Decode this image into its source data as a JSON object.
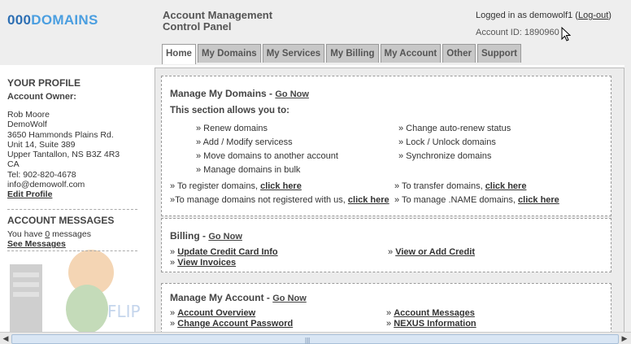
{
  "logo": {
    "part1": "000",
    "part2": "DOMAINS"
  },
  "header": {
    "title_line1": "Account Management",
    "title_line2": "Control Panel",
    "logged_in_prefix": "Logged in as demowolf1 (",
    "logout_label": "Log-out",
    "logged_in_suffix": ")",
    "account_id": "Account ID: 1890960"
  },
  "tabs": [
    "Home",
    "My Domains",
    "My Services",
    "My Billing",
    "My Account",
    "Other",
    "Support"
  ],
  "sidebar": {
    "profile_heading": "YOUR PROFILE",
    "owner_label": "Account Owner:",
    "address": [
      "Rob Moore",
      "DemoWolf",
      "3650 Hammonds Plains Rd.",
      "Unit 14, Suite 389",
      "Upper Tantallon, NS B3Z 4R3",
      "CA",
      "Tel: 902-820-4678",
      "info@demowolf.com"
    ],
    "edit_profile": "Edit Profile",
    "messages_heading": "ACCOUNT MESSAGES",
    "messages_prefix": "You have ",
    "messages_count": "0",
    "messages_suffix": " messages",
    "see_messages": "See Messages",
    "watermark": "FLIPPER"
  },
  "domains_panel": {
    "title": "Manage My Domains",
    "go_now": "Go Now",
    "intro": "This section allows you to:",
    "left_items": [
      "» Renew domains",
      "» Add / Modify servicess",
      "» Move domains to another account",
      "» Manage domains in bulk"
    ],
    "right_items": [
      "» Change auto-renew status",
      "» Lock / Unlock domains",
      "» Synchronize domains"
    ],
    "register_text": "» To register domains, ",
    "transfer_text": "» To transfer domains, ",
    "notreg_text": "»To manage domains not registered with us, ",
    "name_text": "» To manage .NAME domains, ",
    "click_here": "click here"
  },
  "billing_panel": {
    "title": "Billing",
    "go_now": "Go Now",
    "update_cc": "Update Credit Card Info",
    "view_invoices": "View Invoices",
    "view_credit": "View or Add Credit"
  },
  "account_panel": {
    "title": "Manage My Account",
    "go_now": "Go Now",
    "overview": "Account Overview",
    "change_password": "Change Account Password",
    "messages": "Account Messages",
    "nexus": "NEXUS Information"
  },
  "colors": {
    "logo_dark": "#2d6fb3",
    "logo_light": "#4a9ee0",
    "header_bg": "#eeeeee",
    "tab_bg": "#c8c8c8"
  }
}
